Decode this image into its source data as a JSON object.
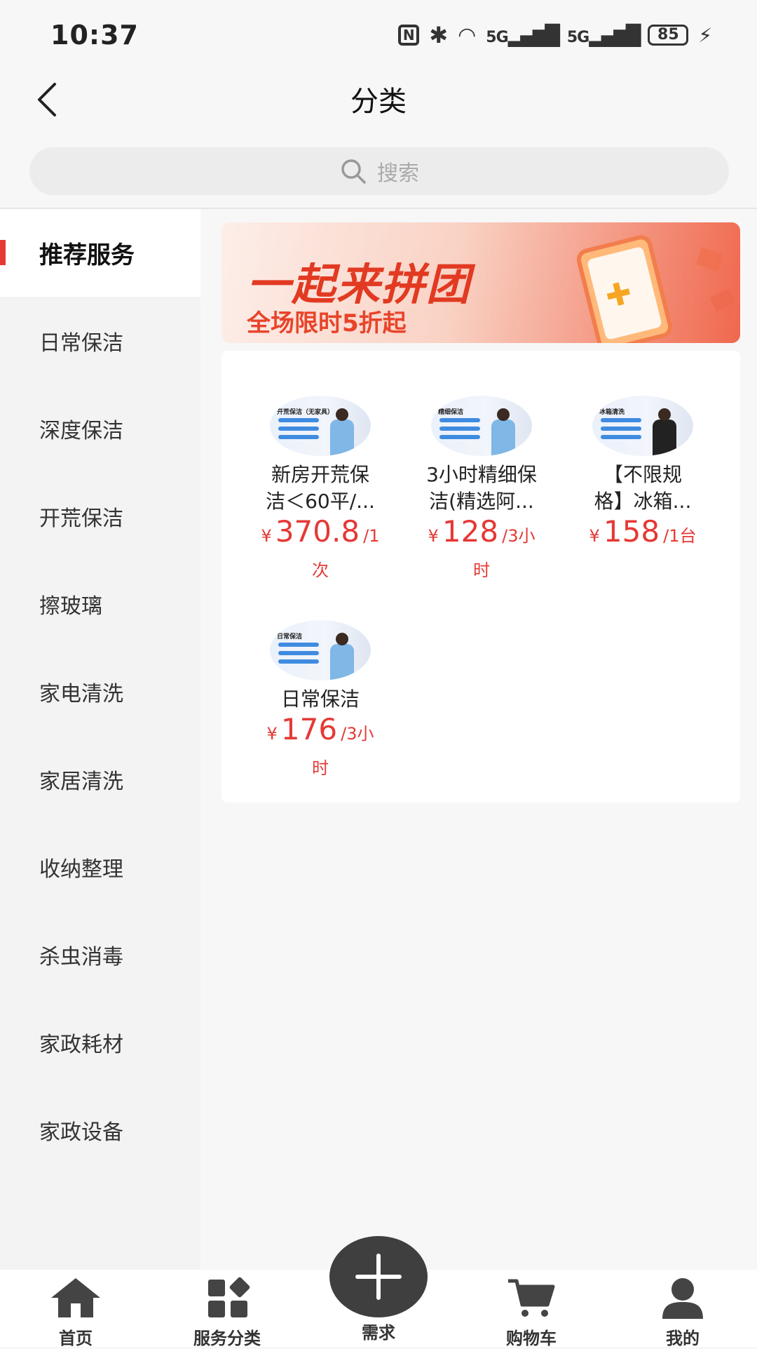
{
  "status_bar": {
    "time": "10:37",
    "nfc": "N",
    "net1": "5G",
    "net2": "5G",
    "battery": "85"
  },
  "header": {
    "title": "分类",
    "back_icon": "chevron-left-icon"
  },
  "search": {
    "placeholder": "搜索",
    "icon": "search-icon"
  },
  "sidebar": {
    "items": [
      {
        "label": "推荐服务",
        "active": true
      },
      {
        "label": "日常保洁"
      },
      {
        "label": "深度保洁"
      },
      {
        "label": "开荒保洁"
      },
      {
        "label": "擦玻璃"
      },
      {
        "label": "家电清洗"
      },
      {
        "label": "家居清洗"
      },
      {
        "label": "收纳整理"
      },
      {
        "label": "杀虫消毒"
      },
      {
        "label": "家政耗材"
      },
      {
        "label": "家政设备"
      }
    ]
  },
  "banner": {
    "title": "一起来拼团",
    "subtitle": "全场限时5折起"
  },
  "products": [
    {
      "name_line1": "新房开荒保",
      "name_line2": "洁＜60平/...",
      "currency": "¥",
      "price": "370.8",
      "unit": "/1",
      "unit_wrap": "次",
      "thumb_text": "开荒保洁（无家具）"
    },
    {
      "name_line1": "3小时精细保",
      "name_line2": "洁(精选阿...",
      "currency": "¥",
      "price": "128",
      "unit": "/3小",
      "unit_wrap": "时",
      "thumb_text": "精细保洁"
    },
    {
      "name_line1": "【不限规",
      "name_line2": "格】冰箱...",
      "currency": "¥",
      "price": "158",
      "unit": "/1台",
      "unit_wrap": "",
      "thumb_text": "冰箱清洗"
    },
    {
      "name_line1": "日常保洁",
      "name_line2": "",
      "currency": "¥",
      "price": "176",
      "unit": "/3小",
      "unit_wrap": "时",
      "thumb_text": "日常保洁"
    }
  ],
  "tabbar": {
    "items": [
      {
        "label": "首页",
        "icon": "home-icon"
      },
      {
        "label": "服务分类",
        "icon": "category-icon"
      },
      {
        "label": "需求",
        "icon": "plus-icon"
      },
      {
        "label": "购物车",
        "icon": "cart-icon"
      },
      {
        "label": "我的",
        "icon": "user-icon"
      }
    ]
  },
  "colors": {
    "accent": "#e53935",
    "banner_text": "#e23a22",
    "fab": "#3f3f3f"
  }
}
